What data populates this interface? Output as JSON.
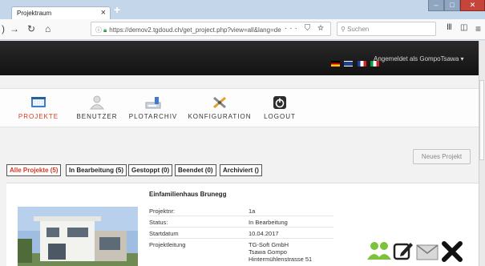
{
  "browser": {
    "tab_title": "Projektraum",
    "tab_close": "×",
    "new_tab": "+",
    "url": "https://demov2.tgdoud.ch/get_project.php?view=all&lang=de",
    "url_actions": "··· ⛉ ☆",
    "search_placeholder": "Suchen",
    "window_buttons": {
      "min": "–",
      "max": "□",
      "close": "✕"
    }
  },
  "header": {
    "logged_in_text": "Angemeldet als GompoTsawa ▾",
    "flags": [
      "de",
      "en",
      "fr",
      "it"
    ]
  },
  "menu": {
    "items": [
      {
        "label": "PROJEKTE",
        "icon": "projects-icon",
        "active": true
      },
      {
        "label": "BENUTZER",
        "icon": "user-icon",
        "active": false
      },
      {
        "label": "PLOTARCHIV",
        "icon": "plotarchive-icon",
        "active": false
      },
      {
        "label": "KONFIGURATION",
        "icon": "configuration-icon",
        "active": false
      },
      {
        "label": "LOGOUT",
        "icon": "logout-icon",
        "active": false
      }
    ]
  },
  "new_project_label": "Neues Projekt",
  "filters": [
    {
      "label": "Alle Projekte (5)",
      "active": true
    },
    {
      "label": "In Bearbeitung (5)",
      "active": false
    },
    {
      "label": "Gestoppt (0)",
      "active": false
    },
    {
      "label": "Beendet (0)",
      "active": false
    },
    {
      "label": "Archiviert ()",
      "active": false
    }
  ],
  "project": {
    "title": "Einfamilienhaus Brunegg",
    "fields": [
      {
        "label": "Projektnr:",
        "value": "1a"
      },
      {
        "label": "Status:",
        "value": "In Bearbeitung"
      },
      {
        "label": "Startdatum",
        "value": "10.04.2017"
      },
      {
        "label": "Projektleitung",
        "value": "TG-Soft GmbH"
      }
    ],
    "contact_lines": [
      "Tsawa Gompo",
      "Hintermühlenstrasse 51"
    ]
  },
  "colors": {
    "accent_red": "#d8381f",
    "header_dark": "#1a1a1a",
    "users_green": "#7cc23a"
  }
}
